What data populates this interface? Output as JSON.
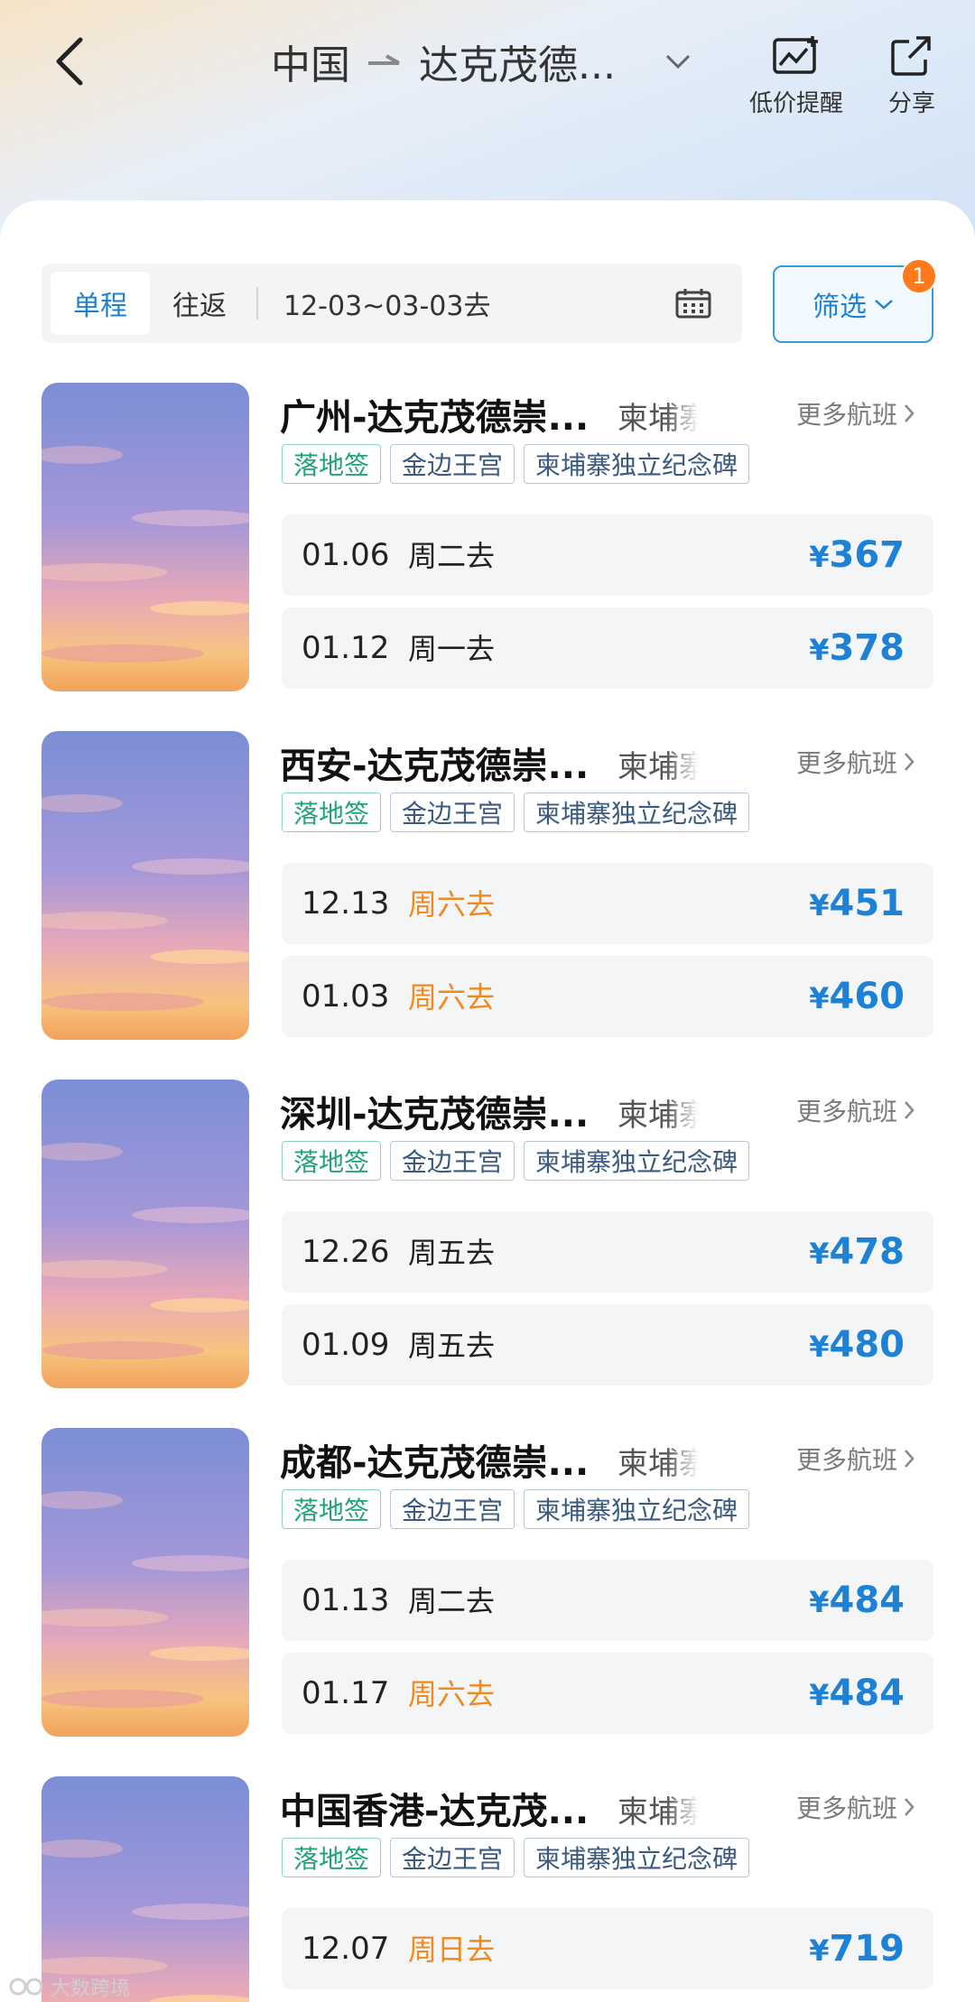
{
  "header": {
    "origin": "中国",
    "destination": "达克茂德...",
    "price_alert_label": "低价提醒",
    "share_label": "分享"
  },
  "toolbar": {
    "one_way_label": "单程",
    "round_trip_label": "往返",
    "date_range": "12-03~03-03去",
    "filter_label": "筛选",
    "filter_badge": "1"
  },
  "colors": {
    "accent": "#1d82d6",
    "weekend": "#f08a1f",
    "badge": "#ff7a1a",
    "tag_green": "#1fa37a"
  },
  "cards": [
    {
      "title": "广州-达克茂德崇...",
      "subtitle": "柬埔寨",
      "more_label": "更多航班",
      "tags": [
        "落地签",
        "金边王宫",
        "柬埔寨独立纪念碑"
      ],
      "fares": [
        {
          "date": "01.06",
          "dow": "周二去",
          "weekend": false,
          "currency": "¥",
          "price": "367"
        },
        {
          "date": "01.12",
          "dow": "周一去",
          "weekend": false,
          "currency": "¥",
          "price": "378"
        }
      ]
    },
    {
      "title": "西安-达克茂德崇...",
      "subtitle": "柬埔寨",
      "more_label": "更多航班",
      "tags": [
        "落地签",
        "金边王宫",
        "柬埔寨独立纪念碑"
      ],
      "fares": [
        {
          "date": "12.13",
          "dow": "周六去",
          "weekend": true,
          "currency": "¥",
          "price": "451"
        },
        {
          "date": "01.03",
          "dow": "周六去",
          "weekend": true,
          "currency": "¥",
          "price": "460"
        }
      ]
    },
    {
      "title": "深圳-达克茂德崇...",
      "subtitle": "柬埔寨",
      "more_label": "更多航班",
      "tags": [
        "落地签",
        "金边王宫",
        "柬埔寨独立纪念碑"
      ],
      "fares": [
        {
          "date": "12.26",
          "dow": "周五去",
          "weekend": false,
          "currency": "¥",
          "price": "478"
        },
        {
          "date": "01.09",
          "dow": "周五去",
          "weekend": false,
          "currency": "¥",
          "price": "480"
        }
      ]
    },
    {
      "title": "成都-达克茂德崇...",
      "subtitle": "柬埔寨",
      "more_label": "更多航班",
      "tags": [
        "落地签",
        "金边王宫",
        "柬埔寨独立纪念碑"
      ],
      "fares": [
        {
          "date": "01.13",
          "dow": "周二去",
          "weekend": false,
          "currency": "¥",
          "price": "484"
        },
        {
          "date": "01.17",
          "dow": "周六去",
          "weekend": true,
          "currency": "¥",
          "price": "484"
        }
      ]
    },
    {
      "title": "中国香港-达克茂...",
      "subtitle": "柬埔寨",
      "more_label": "更多航班",
      "tags": [
        "落地签",
        "金边王宫",
        "柬埔寨独立纪念碑"
      ],
      "fares": [
        {
          "date": "12.07",
          "dow": "周日去",
          "weekend": true,
          "currency": "¥",
          "price": "719"
        }
      ]
    }
  ],
  "watermark": "大数跨境"
}
